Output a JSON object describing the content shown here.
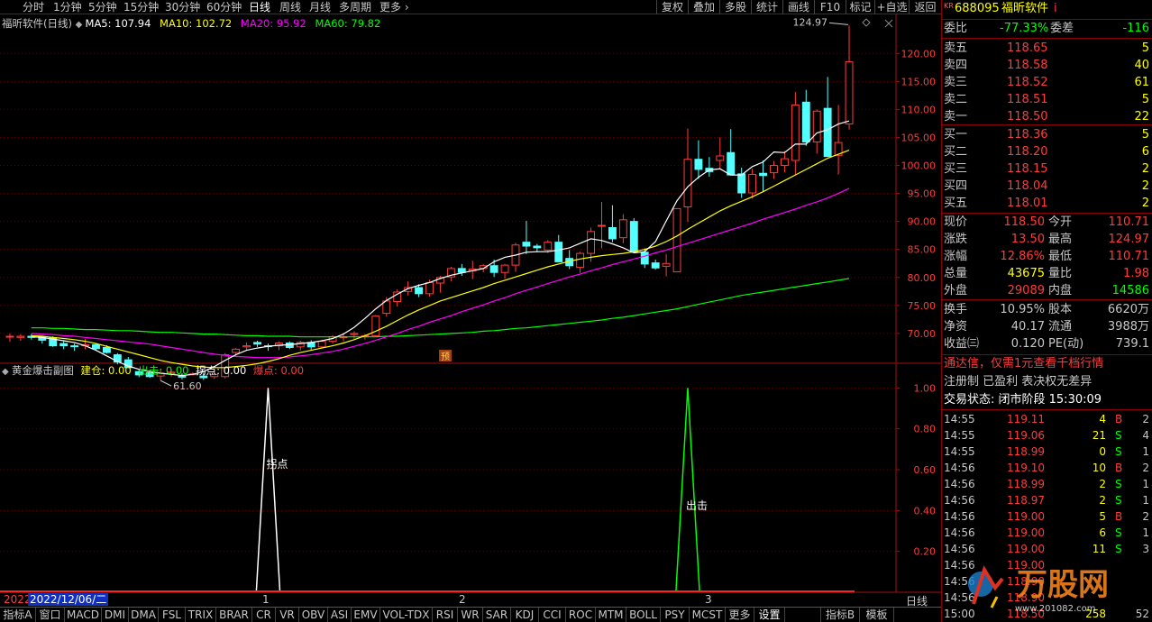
{
  "toolbar": {
    "periods": [
      "分时",
      "1分钟",
      "5分钟",
      "15分钟",
      "30分钟",
      "60分钟",
      "日线",
      "周线",
      "月线",
      "多周期",
      "更多"
    ],
    "active_period": "日线",
    "tools": [
      "复权",
      "叠加",
      "多股",
      "统计",
      "画线",
      "F10",
      "标记",
      "+自选",
      "返回"
    ]
  },
  "main_chart": {
    "title": "福昕软件(日线)",
    "ma5_label": "MA5: 107.94",
    "ma10_label": "MA10: 102.72",
    "ma20_label": "MA20: 95.92",
    "ma60_label": "MA60: 79.82",
    "high_marker": "124.97",
    "low_marker": "61.60",
    "preview_badge": "预",
    "colors": {
      "up": "#ff3c3c",
      "down": "#54ffff",
      "ma5": "#ffffff",
      "ma10": "#ffff00",
      "ma20": "#ff00ff",
      "ma60": "#00ff00"
    }
  },
  "indicator": {
    "title": "黄金爆击副图",
    "jiancang": "建仓: 0.00",
    "chuji": "出击: 0.00",
    "guaidian": "拐点: 0.00",
    "baodian": "爆点: 0.00",
    "peak1_label": "拐点",
    "peak2_label": "出击"
  },
  "chart_data": [
    {
      "type": "candlestick",
      "title": "福昕软件(日线)",
      "ylim": [
        65,
        126
      ],
      "y_ticks": [
        70.0,
        75.0,
        80.0,
        85.0,
        90.0,
        95.0,
        100.0,
        105.0,
        110.0,
        115.0,
        120.0
      ],
      "candles": [
        [
          69.5,
          70.0,
          68.5,
          69.5
        ],
        [
          69.3,
          69.9,
          68.7,
          69.5
        ],
        [
          69.5,
          69.9,
          68.9,
          69.3
        ],
        [
          69.4,
          69.6,
          68.2,
          68.8
        ],
        [
          69.2,
          69.5,
          67.6,
          67.8
        ],
        [
          68.2,
          68.6,
          67.2,
          67.8
        ],
        [
          67.8,
          68.2,
          66.9,
          67.7
        ],
        [
          67.8,
          69.0,
          67.2,
          68.0
        ],
        [
          68.0,
          68.3,
          67.0,
          67.3
        ],
        [
          67.5,
          67.9,
          66.4,
          66.6
        ],
        [
          66.2,
          66.5,
          64.5,
          64.9
        ],
        [
          65.3,
          65.8,
          63.8,
          63.9
        ],
        [
          63.2,
          63.5,
          62.2,
          62.6
        ],
        [
          63.0,
          63.4,
          62.1,
          62.3
        ],
        [
          62.4,
          63.7,
          61.6,
          62.9
        ],
        [
          62.9,
          63.6,
          62.3,
          63.1
        ],
        [
          62.4,
          62.9,
          61.8,
          62.2
        ],
        [
          62.8,
          63.1,
          62.5,
          62.8
        ],
        [
          62.4,
          63.0,
          61.7,
          62.1
        ],
        [
          62.3,
          63.3,
          61.9,
          62.7
        ],
        [
          62.3,
          66.5,
          62.0,
          66.2
        ],
        [
          66.6,
          67.4,
          65.9,
          67.2
        ],
        [
          67.6,
          68.4,
          67.0,
          67.8
        ],
        [
          68.4,
          68.7,
          67.6,
          68.1
        ],
        [
          67.8,
          68.2,
          66.9,
          67.7
        ],
        [
          67.8,
          68.6,
          67.0,
          68.3
        ],
        [
          68.3,
          68.6,
          67.2,
          67.5
        ],
        [
          67.6,
          68.7,
          67.0,
          68.4
        ],
        [
          68.4,
          68.8,
          67.1,
          67.6
        ],
        [
          67.6,
          68.9,
          67.5,
          68.6
        ],
        [
          68.6,
          69.7,
          68.2,
          69.4
        ],
        [
          69.4,
          70.1,
          68.6,
          69.4
        ],
        [
          69.8,
          70.4,
          69.0,
          70.0
        ],
        [
          69.6,
          69.9,
          68.9,
          69.6
        ],
        [
          69.6,
          73.3,
          69.5,
          73.1
        ],
        [
          73.6,
          76.5,
          73.0,
          75.8
        ],
        [
          75.7,
          77.9,
          74.8,
          77.4
        ],
        [
          77.5,
          79.3,
          76.8,
          78.2
        ],
        [
          78.2,
          78.8,
          76.5,
          77.1
        ],
        [
          77.1,
          79.6,
          76.6,
          79.1
        ],
        [
          79.0,
          80.3,
          77.3,
          80.0
        ],
        [
          80.1,
          81.9,
          79.3,
          81.6
        ],
        [
          81.6,
          82.4,
          80.3,
          80.9
        ],
        [
          81.2,
          83.0,
          79.7,
          81.5
        ],
        [
          81.6,
          82.4,
          80.9,
          82.1
        ],
        [
          82.1,
          83.2,
          80.1,
          80.9
        ],
        [
          80.9,
          82.4,
          79.8,
          82.2
        ],
        [
          82.2,
          86.2,
          81.0,
          85.8
        ],
        [
          86.3,
          90.1,
          84.2,
          85.6
        ],
        [
          85.6,
          86.0,
          84.5,
          85.3
        ],
        [
          84.9,
          86.7,
          84.4,
          86.3
        ],
        [
          86.3,
          87.6,
          83.3,
          82.8
        ],
        [
          83.4,
          84.9,
          81.5,
          82.1
        ],
        [
          81.8,
          84.6,
          80.8,
          84.3
        ],
        [
          84.3,
          88.9,
          82.8,
          88.2
        ],
        [
          89.2,
          93.5,
          85.2,
          89.3
        ],
        [
          88.9,
          92.9,
          86.3,
          86.9
        ],
        [
          87.1,
          91.3,
          86.1,
          90.3
        ],
        [
          90.0,
          90.6,
          84.7,
          84.5
        ],
        [
          84.5,
          85.2,
          81.7,
          82.4
        ],
        [
          82.6,
          83.2,
          81.4,
          81.7
        ],
        [
          82.0,
          84.2,
          80.2,
          82.5
        ],
        [
          81.0,
          92.3,
          81.0,
          92.3
        ],
        [
          92.6,
          106.6,
          89.9,
          101.1
        ],
        [
          101.1,
          104.5,
          97.6,
          99.3
        ],
        [
          99.5,
          101.5,
          98.0,
          98.9
        ],
        [
          100.9,
          105.0,
          99.3,
          101.7
        ],
        [
          102.3,
          106.5,
          98.6,
          98.3
        ],
        [
          98.5,
          99.6,
          94.2,
          95.1
        ],
        [
          95.1,
          99.4,
          94.1,
          98.4
        ],
        [
          98.6,
          100.9,
          95.2,
          98.2
        ],
        [
          98.7,
          100.8,
          97.6,
          100.0
        ],
        [
          100.0,
          102.6,
          98.8,
          101.2
        ],
        [
          100.9,
          113.1,
          98.4,
          110.8
        ],
        [
          111.3,
          113.5,
          103.5,
          104.2
        ],
        [
          104.2,
          110.0,
          102.1,
          109.7
        ],
        [
          110.2,
          115.8,
          101.7,
          101.6
        ],
        [
          101.8,
          110.8,
          98.4,
          104.1
        ],
        [
          107.4,
          124.97,
          106.4,
          118.5
        ]
      ],
      "ma5": [
        69.4,
        69.3,
        69.0,
        68.7,
        68.4,
        67.8,
        67.0,
        66.0,
        65.0,
        64.2,
        63.6,
        63.2,
        62.9,
        62.7,
        62.5,
        62.7,
        63.2,
        64.1,
        65.2,
        66.2,
        67.0,
        67.4,
        67.7,
        67.9,
        68.0,
        68.2,
        68.4,
        68.7,
        69.1,
        69.9,
        71.1,
        72.7,
        74.4,
        75.9,
        77.0,
        78.0,
        78.6,
        79.1,
        79.8,
        80.4,
        80.8,
        81.2,
        81.6,
        82.8,
        83.6,
        84.0,
        84.5,
        84.6,
        84.6,
        84.9,
        85.3,
        86.1,
        86.9,
        86.6,
        86.0,
        85.3,
        84.4,
        84.6,
        86.4,
        90.1,
        93.7,
        96.2,
        97.9,
        99.2,
        99.4,
        98.3,
        98.3,
        99.8,
        100.6,
        102.4,
        102.3,
        103.8,
        103.8,
        105.8,
        106.4,
        107.4,
        107.94
      ],
      "ma10": [
        69.6,
        69.5,
        69.3,
        69.1,
        68.9,
        68.6,
        68.2,
        67.7,
        67.2,
        66.7,
        66.2,
        65.7,
        65.2,
        64.8,
        64.5,
        64.2,
        64.0,
        63.9,
        63.9,
        64.1,
        64.3,
        64.6,
        65.0,
        65.5,
        66.1,
        66.6,
        67.0,
        67.4,
        67.8,
        68.3,
        68.9,
        69.6,
        70.4,
        71.3,
        72.3,
        73.3,
        74.2,
        75.0,
        75.8,
        76.4,
        77.0,
        77.6,
        78.2,
        78.9,
        79.5,
        80.1,
        80.7,
        81.3,
        81.9,
        82.4,
        82.9,
        83.3,
        83.6,
        83.9,
        84.1,
        84.3,
        84.6,
        85.0,
        85.6,
        86.4,
        87.4,
        88.6,
        89.7,
        90.8,
        91.9,
        92.8,
        93.6,
        94.4,
        95.3,
        96.3,
        97.3,
        98.3,
        99.3,
        100.3,
        101.3,
        102.0,
        102.72
      ],
      "ma20": [
        70.0,
        69.9,
        69.8,
        69.6,
        69.5,
        69.3,
        69.1,
        68.9,
        68.7,
        68.5,
        68.3,
        68.1,
        67.8,
        67.5,
        67.2,
        66.9,
        66.6,
        66.3,
        66.1,
        65.9,
        65.8,
        65.7,
        65.7,
        65.7,
        65.8,
        66.0,
        66.2,
        66.5,
        66.8,
        67.2,
        67.7,
        68.2,
        68.8,
        69.4,
        70.0,
        70.7,
        71.3,
        72.0,
        72.6,
        73.2,
        73.9,
        74.5,
        75.1,
        75.8,
        76.4,
        77.1,
        77.7,
        78.3,
        78.9,
        79.5,
        80.1,
        80.6,
        81.2,
        81.7,
        82.3,
        82.8,
        83.3,
        83.8,
        84.4,
        84.9,
        85.5,
        86.1,
        86.7,
        87.3,
        87.9,
        88.5,
        89.1,
        89.7,
        90.4,
        91.0,
        91.6,
        92.2,
        92.9,
        93.5,
        94.2,
        95.0,
        95.92
      ],
      "ma60": [
        71.0,
        71.0,
        70.9,
        70.9,
        70.8,
        70.7,
        70.7,
        70.6,
        70.5,
        70.5,
        70.4,
        70.3,
        70.2,
        70.2,
        70.1,
        70.0,
        69.9,
        69.9,
        69.8,
        69.7,
        69.6,
        69.6,
        69.5,
        69.5,
        69.5,
        69.4,
        69.4,
        69.4,
        69.4,
        69.4,
        69.4,
        69.4,
        69.4,
        69.5,
        69.5,
        69.6,
        69.7,
        69.8,
        69.9,
        70.0,
        70.1,
        70.2,
        70.4,
        70.5,
        70.7,
        70.9,
        71.0,
        71.2,
        71.4,
        71.6,
        71.8,
        72.0,
        72.2,
        72.4,
        72.7,
        72.9,
        73.2,
        73.5,
        73.8,
        74.1,
        74.4,
        74.8,
        75.2,
        75.6,
        76.0,
        76.4,
        76.8,
        77.1,
        77.4,
        77.7,
        78.0,
        78.3,
        78.6,
        78.9,
        79.2,
        79.5,
        79.82
      ]
    },
    {
      "type": "line",
      "title": "黄金爆击副图",
      "ylim": [
        0,
        1.05
      ],
      "y_ticks": [
        0.2,
        0.4,
        0.6,
        0.8,
        1.0
      ],
      "series": [
        {
          "name": "拐点",
          "color": "#ffffff",
          "peak_index": 24,
          "values": [
            0,
            1,
            0
          ]
        },
        {
          "name": "出击",
          "color": "#00ff00",
          "peak_index": 63,
          "values": [
            0,
            1,
            0
          ]
        }
      ]
    }
  ],
  "date_axis": {
    "start_label": "2022",
    "cursor_date": "2022/12/06/二",
    "month_labels": [
      "1",
      "2",
      "3"
    ],
    "right_label": "日线"
  },
  "bottom_tabs": [
    "指标A",
    "窗口",
    "MACD",
    "DMI",
    "DMA",
    "FSL",
    "TRIX",
    "BRAR",
    "CR",
    "VR",
    "OBV",
    "ASI",
    "EMV",
    "VOL-TDX",
    "RSI",
    "WR",
    "SAR",
    "KDJ",
    "CCI",
    "ROC",
    "MTM",
    "BOLL",
    "PSY",
    "MCST",
    "更多",
    "设置",
    "指标B",
    "模板"
  ],
  "right_panel": {
    "badge": "KR",
    "code": "688095",
    "name": "福昕软件",
    "info_mark": "i",
    "weibi_label": "委比",
    "weibi_value": "-77.33%",
    "weicha_label": "委差",
    "weicha_value": "-116",
    "asks": [
      {
        "label": "卖五",
        "price": "118.65",
        "vol": "5"
      },
      {
        "label": "卖四",
        "price": "118.58",
        "vol": "40"
      },
      {
        "label": "卖三",
        "price": "118.52",
        "vol": "61"
      },
      {
        "label": "卖二",
        "price": "118.51",
        "vol": "5"
      },
      {
        "label": "卖一",
        "price": "118.50",
        "vol": "22"
      }
    ],
    "bids": [
      {
        "label": "买一",
        "price": "118.36",
        "vol": "5"
      },
      {
        "label": "买二",
        "price": "118.20",
        "vol": "6"
      },
      {
        "label": "买三",
        "price": "118.15",
        "vol": "2"
      },
      {
        "label": "买四",
        "price": "118.04",
        "vol": "2"
      },
      {
        "label": "买五",
        "price": "118.01",
        "vol": "2"
      }
    ],
    "quote": [
      {
        "l1": "现价",
        "v1": "118.50",
        "l2": "今开",
        "v2": "110.71"
      },
      {
        "l1": "涨跌",
        "v1": "13.50",
        "l2": "最高",
        "v2": "124.97"
      },
      {
        "l1": "涨幅",
        "v1": "12.86%",
        "l2": "最低",
        "v2": "110.71"
      },
      {
        "l1": "总量",
        "v1": "43675",
        "l2": "量比",
        "v2": "1.98"
      },
      {
        "l1": "外盘",
        "v1": "29089",
        "l2": "内盘",
        "v2": "14586"
      }
    ],
    "fund": [
      {
        "l1": "换手",
        "v1": "10.95%",
        "l2": "股本",
        "v2": "6620万"
      },
      {
        "l1": "净资",
        "v1": "40.17",
        "l2": "流通",
        "v2": "3988万"
      },
      {
        "l1": "收益㈢",
        "v1": "0.120",
        "l2": "PE(动)",
        "v2": "739.1"
      }
    ],
    "ad1": "通达信，仅需1元查看千档行情",
    "ad2": "注册制 已盈利 表决权无差异",
    "status": "交易状态: 闭市阶段 15:30:09",
    "ticks": [
      {
        "time": "14:55",
        "price": "119.11",
        "vol": "4",
        "bs": "B",
        "n": "2"
      },
      {
        "time": "14:55",
        "price": "119.06",
        "vol": "21",
        "bs": "S",
        "n": "4"
      },
      {
        "time": "14:55",
        "price": "118.99",
        "vol": "0",
        "bs": "S",
        "n": "1"
      },
      {
        "time": "14:56",
        "price": "119.10",
        "vol": "10",
        "bs": "B",
        "n": "2"
      },
      {
        "time": "14:56",
        "price": "118.99",
        "vol": "2",
        "bs": "S",
        "n": "1"
      },
      {
        "time": "14:56",
        "price": "118.97",
        "vol": "2",
        "bs": "S",
        "n": "1"
      },
      {
        "time": "14:56",
        "price": "119.00",
        "vol": "5",
        "bs": "B",
        "n": "2"
      },
      {
        "time": "14:56",
        "price": "119.00",
        "vol": "6",
        "bs": "S",
        "n": "1"
      },
      {
        "time": "14:56",
        "price": "119.00",
        "vol": "11",
        "bs": "S",
        "n": "3"
      },
      {
        "time": "14:56",
        "price": "119.00",
        "vol": "",
        "bs": "",
        "n": ""
      },
      {
        "time": "14:56",
        "price": "118.90",
        "vol": "",
        "bs": "",
        "n": ""
      },
      {
        "time": "14:56",
        "price": "118.90",
        "vol": "",
        "bs": "",
        "n": ""
      },
      {
        "time": "15:00",
        "price": "118.50",
        "vol": "258",
        "bs": "",
        "n": "52"
      }
    ]
  },
  "watermark": {
    "brand": "万股网",
    "url": "www.201082.com"
  }
}
